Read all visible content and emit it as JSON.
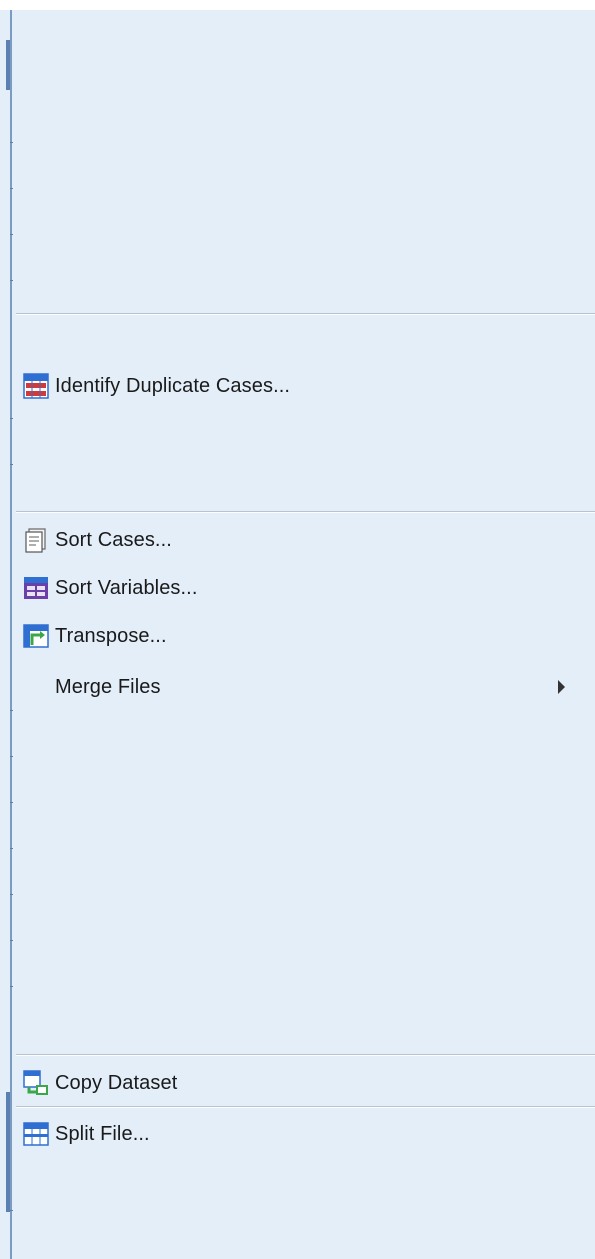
{
  "menu": {
    "items": {
      "identify_duplicates": {
        "label": "Identify Duplicate Cases...",
        "icon": "identify-duplicates-icon"
      },
      "sort_cases": {
        "label": "Sort Cases...",
        "icon": "sort-cases-icon"
      },
      "sort_variables": {
        "label": "Sort Variables...",
        "icon": "sort-variables-icon"
      },
      "transpose": {
        "label": "Transpose...",
        "icon": "transpose-icon"
      },
      "merge_files": {
        "label": "Merge Files",
        "has_submenu": true
      },
      "copy_dataset": {
        "label": "Copy Dataset",
        "icon": "copy-dataset-icon"
      },
      "split_file": {
        "label": "Split File...",
        "icon": "split-file-icon"
      }
    }
  },
  "colors": {
    "menu_background": "#e3eef9",
    "separator": "#b9c3cf",
    "text": "#1a1a1a",
    "icon_blue": "#2f6fd1",
    "icon_red": "#d23a3a",
    "icon_green": "#3aa84a",
    "icon_purple": "#6b3fa8"
  }
}
